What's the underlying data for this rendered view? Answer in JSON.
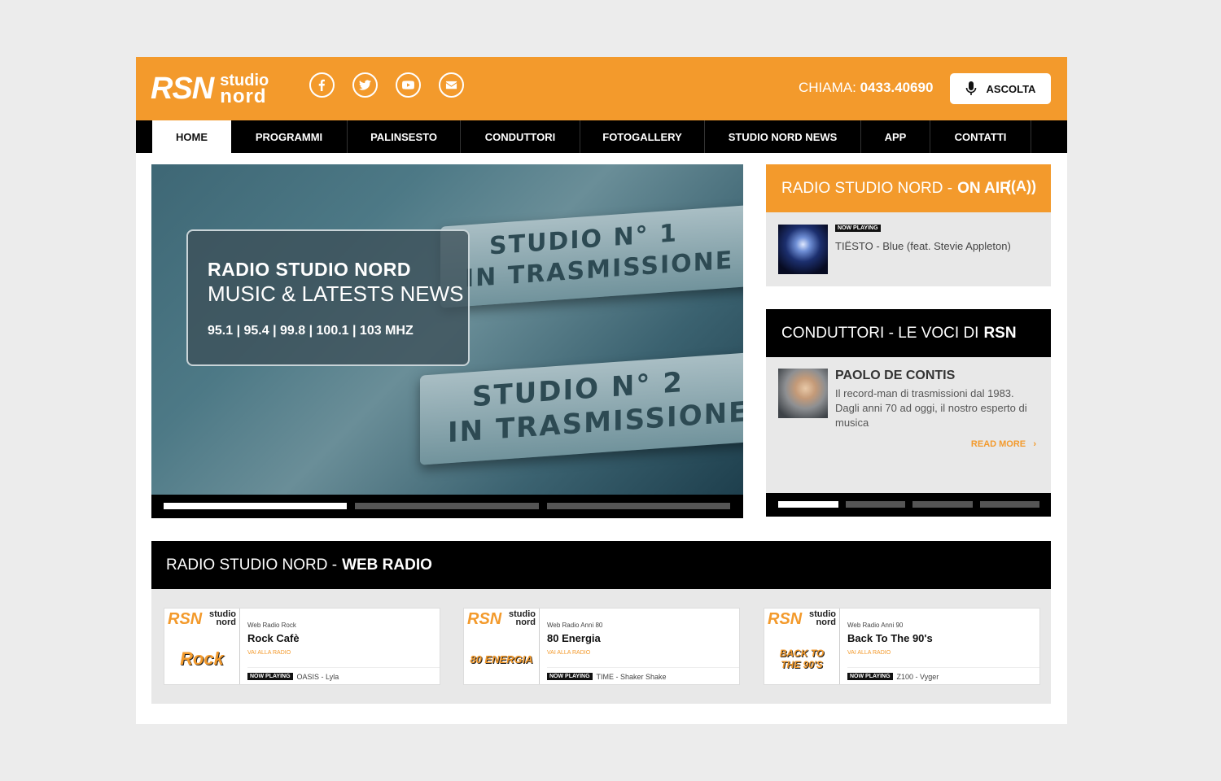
{
  "header": {
    "logo_mark": "RSN",
    "logo_line1": "studio",
    "logo_line2": "nord",
    "socials": [
      "facebook-icon",
      "twitter-icon",
      "youtube-icon",
      "email-icon"
    ],
    "call_label": "CHIAMA:",
    "call_number": "0433.40690",
    "listen_label": "ASCOLTA"
  },
  "nav": {
    "items": [
      "HOME",
      "PROGRAMMI",
      "PALINSESTO",
      "CONDUTTORI",
      "FOTOGALLERY",
      "STUDIO NORD NEWS",
      "APP",
      "CONTATTI"
    ],
    "active": "HOME"
  },
  "hero": {
    "plaque1_line1": "STUDIO N° 1",
    "plaque1_line2": "IN TRASMISSIONE",
    "plaque2_line1": "STUDIO N° 2",
    "plaque2_line2": "IN TRASMISSIONE",
    "title": "RADIO STUDIO NORD",
    "subtitle": "MUSIC & LATESTS NEWS",
    "frequencies": "95.1 | 95.4 | 99.8 | 100.1 | 103 MHZ",
    "slide_count": 3,
    "active_slide": 1
  },
  "on_air": {
    "title_prefix": "RADIO STUDIO NORD -",
    "title_bold": "ON AIR",
    "icon": "broadcast-icon",
    "icon_glyph": "((A))",
    "badge": "NOW PLAYING",
    "track": "TIËSTO - Blue (feat. Stevie Appleton)"
  },
  "conduttori": {
    "title_prefix": "CONDUTTORI - LE VOCI DI",
    "title_bold": "RSN",
    "name": "PAOLO DE CONTIS",
    "description": "Il record-man di trasmissioni dal 1983. Dagli anni 70 ad oggi, il nostro esperto di musica",
    "read_more": "READ MORE",
    "slide_count": 4,
    "active_slide": 1
  },
  "web_radio": {
    "title_prefix": "RADIO STUDIO NORD -",
    "title_bold": "WEB RADIO",
    "cards": [
      {
        "type": "Web Radio Rock",
        "title": "Rock Cafè",
        "link": "VAI ALLA RADIO",
        "badge": "NOW PLAYING",
        "track": "OASIS - Lyla",
        "art": "Rock"
      },
      {
        "type": "Web Radio Anni 80",
        "title": "80 Energia",
        "link": "VAI ALLA RADIO",
        "badge": "NOW PLAYING",
        "track": "TIME - Shaker Shake",
        "art": "80 ENERGIA"
      },
      {
        "type": "Web Radio Anni 90",
        "title": "Back To The 90's",
        "link": "VAI ALLA RADIO",
        "badge": "NOW PLAYING",
        "track": "Z100 - Vyger",
        "art": "BACK TO THE 90'S"
      }
    ]
  },
  "colors": {
    "brand_orange": "#f39a2c",
    "black": "#000000",
    "panel_gray": "#e8e8e8"
  }
}
